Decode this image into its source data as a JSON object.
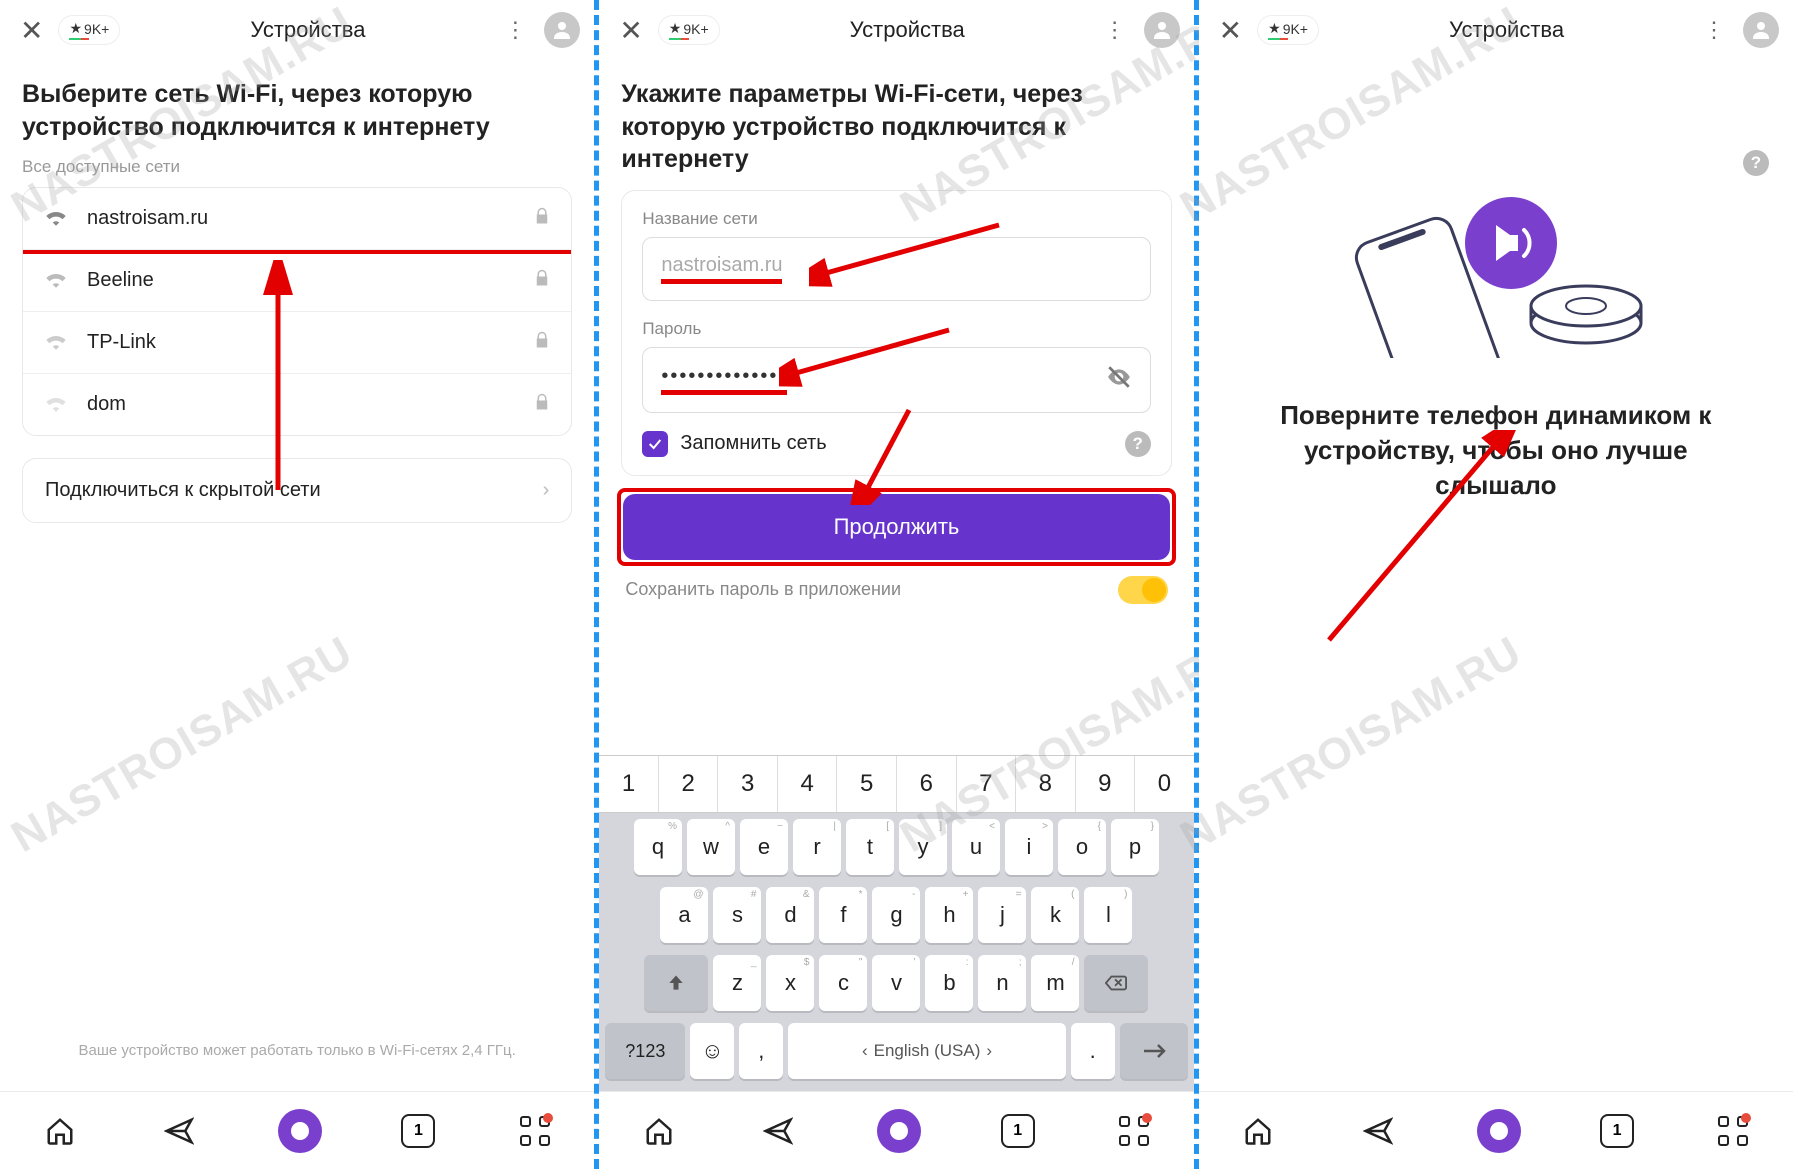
{
  "watermark_text": "NASTROISAM.RU",
  "topbar": {
    "chip_label": "9K+",
    "tab_title": "Устройства"
  },
  "pane1": {
    "heading": "Выберите сеть Wi-Fi, через которую устройство подключится к интернету",
    "all_networks_label": "Все доступные сети",
    "networks": [
      {
        "name": "nastroisam.ru",
        "strength": "strong",
        "locked": true,
        "highlighted": true
      },
      {
        "name": "Beeline",
        "strength": "strong",
        "locked": true,
        "highlighted": false
      },
      {
        "name": "TP-Link",
        "strength": "medium",
        "locked": true,
        "highlighted": false
      },
      {
        "name": "dom",
        "strength": "weak",
        "locked": true,
        "highlighted": false
      }
    ],
    "hidden_network_label": "Подключиться к скрытой сети",
    "footer_note": "Ваше устройство может работать только в Wi-Fi-сетях 2,4 ГГц."
  },
  "pane2": {
    "heading": "Укажите параметры Wi-Fi-сети, через которую устройство подключится к интернету",
    "name_label": "Название сети",
    "name_value": "nastroisam.ru",
    "password_label": "Пароль",
    "password_value": "••••••••••••••",
    "remember_label": "Запомнить сеть",
    "continue_label": "Продолжить",
    "save_password_label": "Сохранить пароль в приложении",
    "save_password_on": true
  },
  "keyboard": {
    "numbers": [
      "1",
      "2",
      "3",
      "4",
      "5",
      "6",
      "7",
      "8",
      "9",
      "0"
    ],
    "row1": [
      {
        "k": "q",
        "s": "%"
      },
      {
        "k": "w",
        "s": "^"
      },
      {
        "k": "e",
        "s": "~"
      },
      {
        "k": "r",
        "s": "|"
      },
      {
        "k": "t",
        "s": "["
      },
      {
        "k": "y",
        "s": "]"
      },
      {
        "k": "u",
        "s": "<"
      },
      {
        "k": "i",
        "s": ">"
      },
      {
        "k": "o",
        "s": "{"
      },
      {
        "k": "p",
        "s": "}"
      }
    ],
    "row2": [
      {
        "k": "a",
        "s": "@"
      },
      {
        "k": "s",
        "s": "#"
      },
      {
        "k": "d",
        "s": "&"
      },
      {
        "k": "f",
        "s": "*"
      },
      {
        "k": "g",
        "s": "-"
      },
      {
        "k": "h",
        "s": "+"
      },
      {
        "k": "j",
        "s": "="
      },
      {
        "k": "k",
        "s": "("
      },
      {
        "k": "l",
        "s": ")"
      }
    ],
    "row3": [
      {
        "k": "z",
        "s": "_"
      },
      {
        "k": "x",
        "s": "$"
      },
      {
        "k": "c",
        "s": "\""
      },
      {
        "k": "v",
        "s": "'"
      },
      {
        "k": "b",
        "s": ":"
      },
      {
        "k": "n",
        "s": ";"
      },
      {
        "k": "m",
        "s": "/"
      }
    ],
    "symkey_label": "?123",
    "comma": ",",
    "space_label": "English (USA)",
    "dot": "."
  },
  "pane3": {
    "instruction": "Поверните телефон динамиком к устройству, чтобы оно лучше слышало"
  },
  "bottombar": {
    "tabs_count": "1"
  }
}
